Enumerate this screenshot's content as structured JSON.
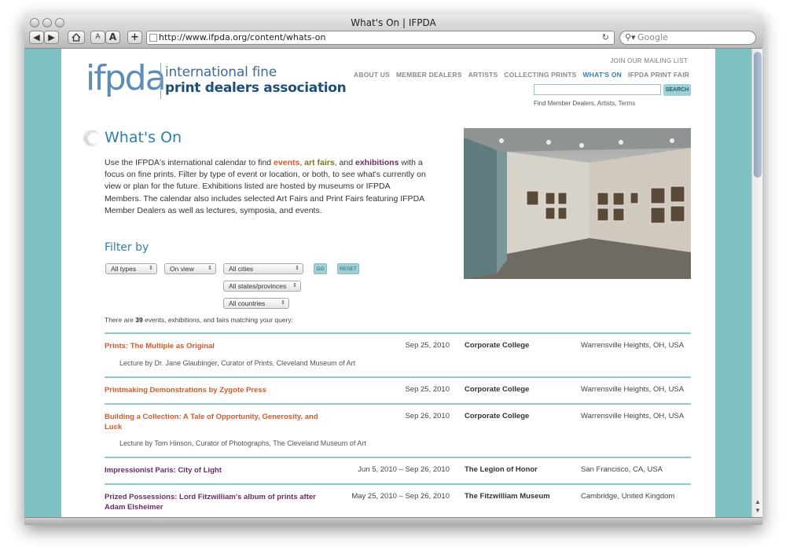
{
  "browser": {
    "window_title": "What's On | IFPDA",
    "url": "http://www.ifpda.org/content/whats-on",
    "search_placeholder": "Google",
    "text_smaller": "A",
    "text_larger": "A",
    "add_bookmark": "+"
  },
  "header": {
    "logo_mark": "ifpda",
    "logo_line1": "international fine",
    "logo_line2": "print dealers association",
    "mailing_link": "JOIN OUR MAILING LIST",
    "nav": [
      "ABOUT US",
      "MEMBER DEALERS",
      "ARTISTS",
      "COLLECTING PRINTS",
      "WHAT'S ON",
      "IFPDA PRINT FAIR"
    ],
    "active_nav": "WHAT'S ON",
    "search_button": "SEARCH",
    "search_hint": "Find Member Dealers, Artists, Terms"
  },
  "main": {
    "title": "What's On",
    "intro_pre": "Use the IFPDA's international calendar to find ",
    "kw_events": "events",
    "sep1": ", ",
    "kw_fairs": "art fairs",
    "sep2": ", and ",
    "kw_exhibitions": "exhibitions",
    "intro_post": " with a focus on fine prints. Filter by type of event or location, or both, to see what's currently on view or plan for the future. Exhibitions listed are hosted by museums or IFPDA Members. The calendar also includes selected Art Fairs and Print Fairs featuring IFPDA Member Dealers as well as lectures, symposia, and events.",
    "filter_title": "Filter by",
    "filters": {
      "type": "All types",
      "timing": "On view",
      "city": "All cities",
      "state": "All states/provinces",
      "country": "All countries",
      "go": "GO",
      "reset": "RESET"
    },
    "count_pre": "There are ",
    "count": "39",
    "count_post": " events, exhibitions, and fairs matching your query:"
  },
  "events": [
    {
      "title": "Prints: The Multiple as Original",
      "date": "Sep 25, 2010",
      "venue": "Corporate College",
      "location": "Warrensville Heights, OH, USA",
      "description": "Lecture by Dr. Jane Glaubinger, Curator of Prints, Cleveland Museum of Art"
    },
    {
      "title": "Printmaking Demonstrations by Zygote Press",
      "date": "Sep 25, 2010",
      "venue": "Corporate College",
      "location": "Warrensville Heights, OH, USA",
      "description": ""
    },
    {
      "title": "Building a Collection: A Tale of Opportunity, Generosity, and Luck",
      "date": "Sep 26, 2010",
      "venue": "Corporate College",
      "location": "Warrensville Heights, OH, USA",
      "description": "Lecture by Tom Hinson, Curator of Photographs, The Cleveland Museum of Art"
    },
    {
      "title": "Impressionist Paris: City of Light",
      "date": "Jun 5, 2010 – Sep 26, 2010",
      "venue": "The Legion of Honor",
      "location": "San Francisco, CA, USA",
      "description": ""
    },
    {
      "title": "Prized Possessions: Lord Fitzwilliam's album of prints after Adam Elsheimer",
      "date": "May 25, 2010 – Sep 26, 2010",
      "venue": "The Fitzwilliam Museum",
      "location": "Cambridge, United Kingdom",
      "description": ""
    }
  ],
  "colors": {
    "accent_blue": "#2f7eb0",
    "event_orange": "#d25a2a",
    "exhibition_purple": "#6b2b6b",
    "teal_rule": "#8fcad0"
  },
  "icons": {
    "back": "back-arrow-icon",
    "forward": "forward-arrow-icon",
    "home": "home-icon",
    "reload": "reload-icon",
    "search": "magnifier-icon"
  }
}
